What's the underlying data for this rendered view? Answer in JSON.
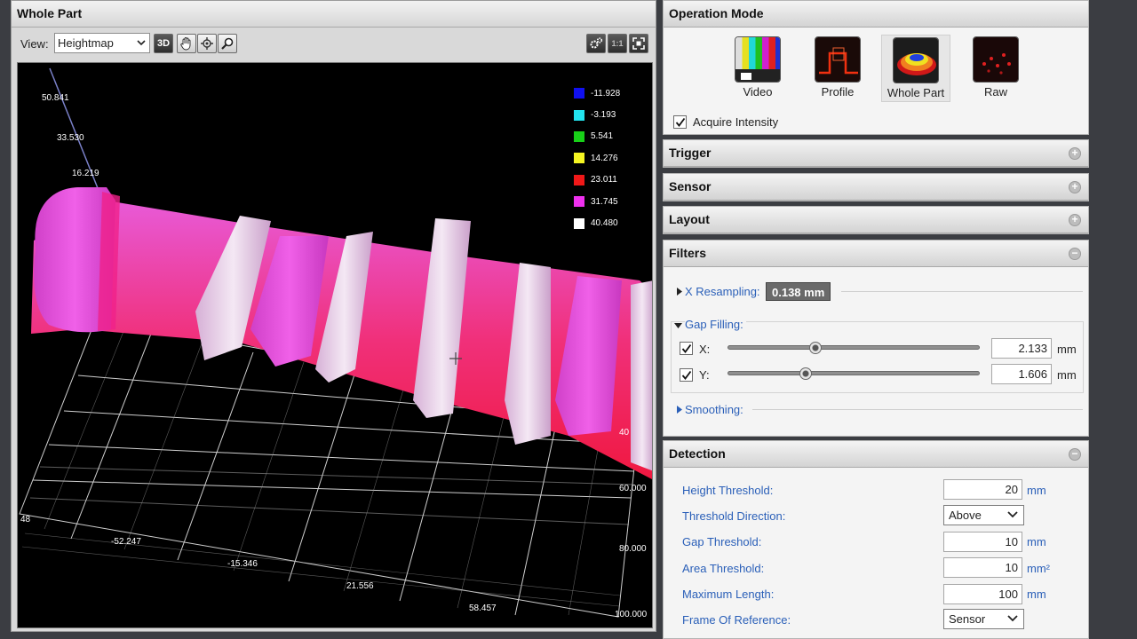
{
  "left_panel": {
    "title": "Whole Part",
    "view_label": "View:",
    "view_selected": "Heightmap",
    "toolbar": {
      "btn_3d": "3D",
      "btn_11": "1:1"
    },
    "axis_labels": {
      "z": [
        "50.841",
        "33.530",
        "16.219"
      ],
      "x": [
        "-52.247",
        "-15.346",
        "21.556",
        "58.457"
      ],
      "y": [
        "40",
        "60.000",
        "80.000",
        "100.000"
      ],
      "corner": "48"
    },
    "legend": [
      {
        "value": "-11.928",
        "color": "#1010f0"
      },
      {
        "value": "-3.193",
        "color": "#22e3ee"
      },
      {
        "value": "5.541",
        "color": "#18d018"
      },
      {
        "value": "14.276",
        "color": "#f5f522"
      },
      {
        "value": "23.011",
        "color": "#f01818"
      },
      {
        "value": "31.745",
        "color": "#ee30ee"
      },
      {
        "value": "40.480",
        "color": "#ffffff"
      }
    ]
  },
  "operation_mode": {
    "title": "Operation Mode",
    "modes": [
      {
        "label": "Video",
        "icon": "video-icon"
      },
      {
        "label": "Profile",
        "icon": "profile-icon"
      },
      {
        "label": "Whole Part",
        "icon": "whole-part-icon"
      },
      {
        "label": "Raw",
        "icon": "raw-icon"
      }
    ],
    "active_mode": "Whole Part",
    "acquire_intensity_label": "Acquire Intensity",
    "acquire_intensity_checked": true
  },
  "trigger": {
    "title": "Trigger",
    "expander": "+"
  },
  "sensor": {
    "title": "Sensor",
    "expander": "+"
  },
  "layout": {
    "title": "Layout",
    "expander": "+"
  },
  "filters": {
    "title": "Filters",
    "expander": "−",
    "x_resampling_label": "X Resampling:",
    "x_resampling_value": "0.138 mm",
    "gap_filling_label": "Gap Filling:",
    "gap_x_label": "X:",
    "gap_x_value": "2.133",
    "gap_x_unit": "mm",
    "gap_x_level": 0.35,
    "gap_y_label": "Y:",
    "gap_y_value": "1.606",
    "gap_y_unit": "mm",
    "gap_y_level": 0.31,
    "smoothing_label": "Smoothing:"
  },
  "detection": {
    "title": "Detection",
    "expander": "−",
    "rows": [
      {
        "label": "Height Threshold:",
        "value": "20",
        "unit": "mm"
      },
      {
        "label": "Threshold Direction:",
        "value": "Above"
      },
      {
        "label": "Gap Threshold:",
        "value": "10",
        "unit": "mm"
      },
      {
        "label": "Area Threshold:",
        "value": "10",
        "unit": "mm²"
      },
      {
        "label": "Maximum Length:",
        "value": "100",
        "unit": "mm"
      },
      {
        "label": "Frame Of Reference:",
        "value": "Sensor"
      }
    ]
  }
}
